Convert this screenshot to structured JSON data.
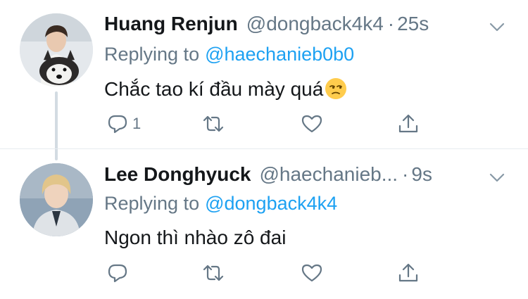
{
  "tweets": [
    {
      "name": "Huang Renjun",
      "handle": "@dongback4k4",
      "separator": "·",
      "time": "25s",
      "replying_prefix": "Replying to",
      "replying_to": "@haechanieb0b0",
      "text": "Chắc tao kí đầu mày quá",
      "emoji": "unamused-face",
      "reply_count": "1"
    },
    {
      "name": "Lee Donghyuck",
      "handle": "@haechanieb...",
      "separator": "·",
      "time": "9s",
      "replying_prefix": "Replying to",
      "replying_to": "@dongback4k4",
      "text": "Ngon thì nhào zô đai",
      "reply_count": ""
    }
  ],
  "icons": {
    "reply": "reply-icon",
    "retweet": "retweet-icon",
    "like": "heart-icon",
    "share": "share-icon",
    "menu": "chevron-down-icon"
  },
  "colors": {
    "link": "#1da1f2",
    "secondary": "#657786",
    "text": "#14171a"
  }
}
